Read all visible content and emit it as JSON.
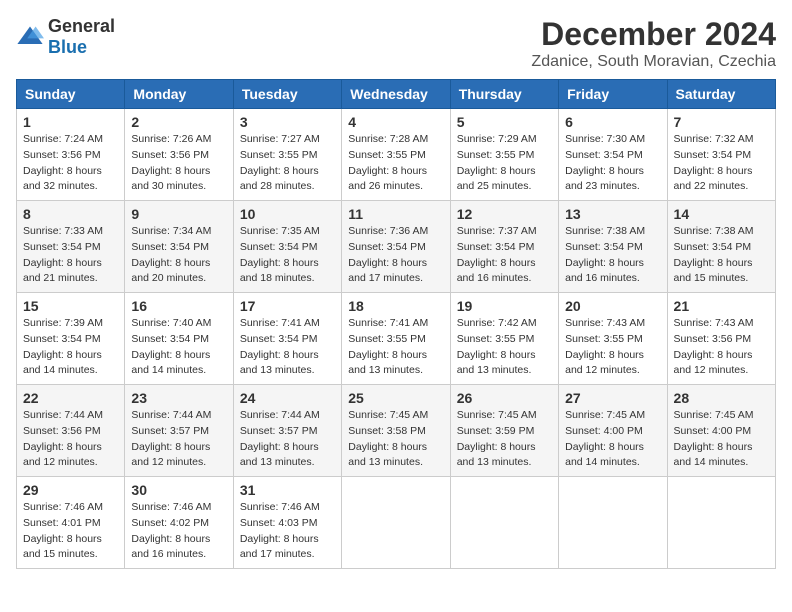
{
  "logo": {
    "general": "General",
    "blue": "Blue"
  },
  "title": "December 2024",
  "location": "Zdanice, South Moravian, Czechia",
  "weekdays": [
    "Sunday",
    "Monday",
    "Tuesday",
    "Wednesday",
    "Thursday",
    "Friday",
    "Saturday"
  ],
  "weeks": [
    [
      {
        "day": "1",
        "sunrise": "7:24 AM",
        "sunset": "3:56 PM",
        "daylight": "8 hours and 32 minutes."
      },
      {
        "day": "2",
        "sunrise": "7:26 AM",
        "sunset": "3:56 PM",
        "daylight": "8 hours and 30 minutes."
      },
      {
        "day": "3",
        "sunrise": "7:27 AM",
        "sunset": "3:55 PM",
        "daylight": "8 hours and 28 minutes."
      },
      {
        "day": "4",
        "sunrise": "7:28 AM",
        "sunset": "3:55 PM",
        "daylight": "8 hours and 26 minutes."
      },
      {
        "day": "5",
        "sunrise": "7:29 AM",
        "sunset": "3:55 PM",
        "daylight": "8 hours and 25 minutes."
      },
      {
        "day": "6",
        "sunrise": "7:30 AM",
        "sunset": "3:54 PM",
        "daylight": "8 hours and 23 minutes."
      },
      {
        "day": "7",
        "sunrise": "7:32 AM",
        "sunset": "3:54 PM",
        "daylight": "8 hours and 22 minutes."
      }
    ],
    [
      {
        "day": "8",
        "sunrise": "7:33 AM",
        "sunset": "3:54 PM",
        "daylight": "8 hours and 21 minutes."
      },
      {
        "day": "9",
        "sunrise": "7:34 AM",
        "sunset": "3:54 PM",
        "daylight": "8 hours and 20 minutes."
      },
      {
        "day": "10",
        "sunrise": "7:35 AM",
        "sunset": "3:54 PM",
        "daylight": "8 hours and 18 minutes."
      },
      {
        "day": "11",
        "sunrise": "7:36 AM",
        "sunset": "3:54 PM",
        "daylight": "8 hours and 17 minutes."
      },
      {
        "day": "12",
        "sunrise": "7:37 AM",
        "sunset": "3:54 PM",
        "daylight": "8 hours and 16 minutes."
      },
      {
        "day": "13",
        "sunrise": "7:38 AM",
        "sunset": "3:54 PM",
        "daylight": "8 hours and 16 minutes."
      },
      {
        "day": "14",
        "sunrise": "7:38 AM",
        "sunset": "3:54 PM",
        "daylight": "8 hours and 15 minutes."
      }
    ],
    [
      {
        "day": "15",
        "sunrise": "7:39 AM",
        "sunset": "3:54 PM",
        "daylight": "8 hours and 14 minutes."
      },
      {
        "day": "16",
        "sunrise": "7:40 AM",
        "sunset": "3:54 PM",
        "daylight": "8 hours and 14 minutes."
      },
      {
        "day": "17",
        "sunrise": "7:41 AM",
        "sunset": "3:54 PM",
        "daylight": "8 hours and 13 minutes."
      },
      {
        "day": "18",
        "sunrise": "7:41 AM",
        "sunset": "3:55 PM",
        "daylight": "8 hours and 13 minutes."
      },
      {
        "day": "19",
        "sunrise": "7:42 AM",
        "sunset": "3:55 PM",
        "daylight": "8 hours and 13 minutes."
      },
      {
        "day": "20",
        "sunrise": "7:43 AM",
        "sunset": "3:55 PM",
        "daylight": "8 hours and 12 minutes."
      },
      {
        "day": "21",
        "sunrise": "7:43 AM",
        "sunset": "3:56 PM",
        "daylight": "8 hours and 12 minutes."
      }
    ],
    [
      {
        "day": "22",
        "sunrise": "7:44 AM",
        "sunset": "3:56 PM",
        "daylight": "8 hours and 12 minutes."
      },
      {
        "day": "23",
        "sunrise": "7:44 AM",
        "sunset": "3:57 PM",
        "daylight": "8 hours and 12 minutes."
      },
      {
        "day": "24",
        "sunrise": "7:44 AM",
        "sunset": "3:57 PM",
        "daylight": "8 hours and 13 minutes."
      },
      {
        "day": "25",
        "sunrise": "7:45 AM",
        "sunset": "3:58 PM",
        "daylight": "8 hours and 13 minutes."
      },
      {
        "day": "26",
        "sunrise": "7:45 AM",
        "sunset": "3:59 PM",
        "daylight": "8 hours and 13 minutes."
      },
      {
        "day": "27",
        "sunrise": "7:45 AM",
        "sunset": "4:00 PM",
        "daylight": "8 hours and 14 minutes."
      },
      {
        "day": "28",
        "sunrise": "7:45 AM",
        "sunset": "4:00 PM",
        "daylight": "8 hours and 14 minutes."
      }
    ],
    [
      {
        "day": "29",
        "sunrise": "7:46 AM",
        "sunset": "4:01 PM",
        "daylight": "8 hours and 15 minutes."
      },
      {
        "day": "30",
        "sunrise": "7:46 AM",
        "sunset": "4:02 PM",
        "daylight": "8 hours and 16 minutes."
      },
      {
        "day": "31",
        "sunrise": "7:46 AM",
        "sunset": "4:03 PM",
        "daylight": "8 hours and 17 minutes."
      },
      null,
      null,
      null,
      null
    ]
  ],
  "labels": {
    "sunrise": "Sunrise:",
    "sunset": "Sunset:",
    "daylight": "Daylight:"
  }
}
